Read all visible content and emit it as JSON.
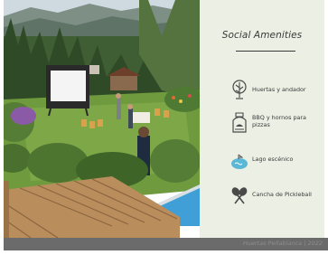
{
  "slide": {
    "title": "Social Amenities",
    "amenities": [
      {
        "icon": "tree-icon",
        "label": "Huertas y andador"
      },
      {
        "icon": "oven-icon",
        "label": "BBQ y hornos para pizzas"
      },
      {
        "icon": "lake-icon",
        "label": "Lago escénico"
      },
      {
        "icon": "pickleball-icon",
        "label": "Cancha de Pickleball"
      }
    ],
    "footer": "Huertas Peñablanca | 2022"
  },
  "colors": {
    "panel_background": "#ecefe4",
    "footer_bar": "#6b6b6b",
    "lake_icon": "#5ab8d6",
    "text": "#3a3a3a"
  }
}
